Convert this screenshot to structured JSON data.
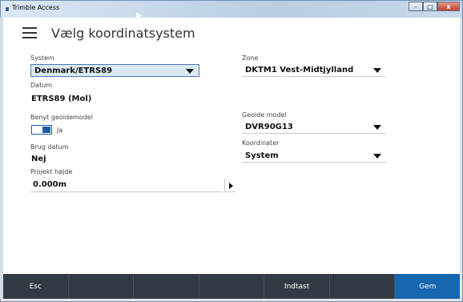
{
  "window": {
    "title": "Trimble Access",
    "controls": [
      "–",
      "□",
      "x"
    ]
  },
  "header": {
    "title": "Vælg koordinatsystem"
  },
  "left": {
    "system_label": "System",
    "system_value": "Denmark/ETRS89",
    "datum_label": "Datum",
    "datum_value": "ETRS89 (Mol)",
    "geoid_toggle_label": "Benyt geoidemodel",
    "geoid_toggle_state": "Ja",
    "brug_datum_label": "Brug datum",
    "brug_datum_value": "Nej",
    "projekt_hojde_label": "Projekt højde",
    "projekt_hojde_value": "0.000m"
  },
  "right": {
    "zone_label": "Zone",
    "zone_value": "DKTM1 Vest-Midtjylland",
    "geoide_label": "Geoide model",
    "geoide_value": "DVR90G13",
    "koordinater_label": "Koordinater",
    "koordinater_value": "System"
  },
  "footer": {
    "buttons": [
      "Esc",
      "",
      "",
      "",
      "Indtast",
      "",
      "Gem"
    ]
  },
  "colors": {
    "accent": "#1766b0",
    "footer_bg": "#343a44",
    "active_select_bg": "#dbe9f4"
  }
}
